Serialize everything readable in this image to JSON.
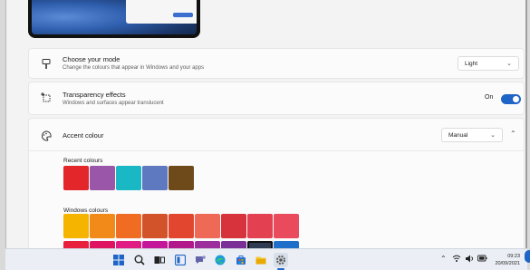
{
  "mode": {
    "title": "Choose your mode",
    "subtitle": "Change the colours that appear in Windows and your apps",
    "value": "Light"
  },
  "transparency": {
    "title": "Transparency effects",
    "subtitle": "Windows and surfaces appear translucent",
    "toggle_label": "On",
    "enabled": true
  },
  "accent": {
    "title": "Accent colour",
    "value": "Manual",
    "recent_label": "Recent colours",
    "windows_label": "Windows colours",
    "recent_colours": [
      "#e2262a",
      "#9a57a9",
      "#1ab8c4",
      "#5f79c0",
      "#6e4a1b"
    ],
    "windows_colours_row1": [
      "#f4b400",
      "#f28a1a",
      "#ef6c22",
      "#d2522a",
      "#e2462f",
      "#ef6957",
      "#d6333c",
      "#e34151",
      "#e94b5c"
    ],
    "windows_colours_row2": [
      "#e81f3d",
      "#e01561",
      "#e11c82",
      "#c5179a",
      "#b3188b",
      "#9b2d9d",
      "#7a2f97",
      "#2e3b52",
      "#1e6fc9"
    ]
  },
  "taskbar": {
    "icons": [
      "windows-start-icon",
      "search-icon",
      "task-view-icon",
      "widgets-icon",
      "chat-icon",
      "edge-icon",
      "store-icon",
      "file-explorer-icon",
      "settings-icon"
    ],
    "time": "09:23",
    "date": "20/09/2021"
  },
  "colors": {
    "accent": "#1f64c7",
    "background": "#f3f3f3",
    "card": "#fbfbfb"
  }
}
